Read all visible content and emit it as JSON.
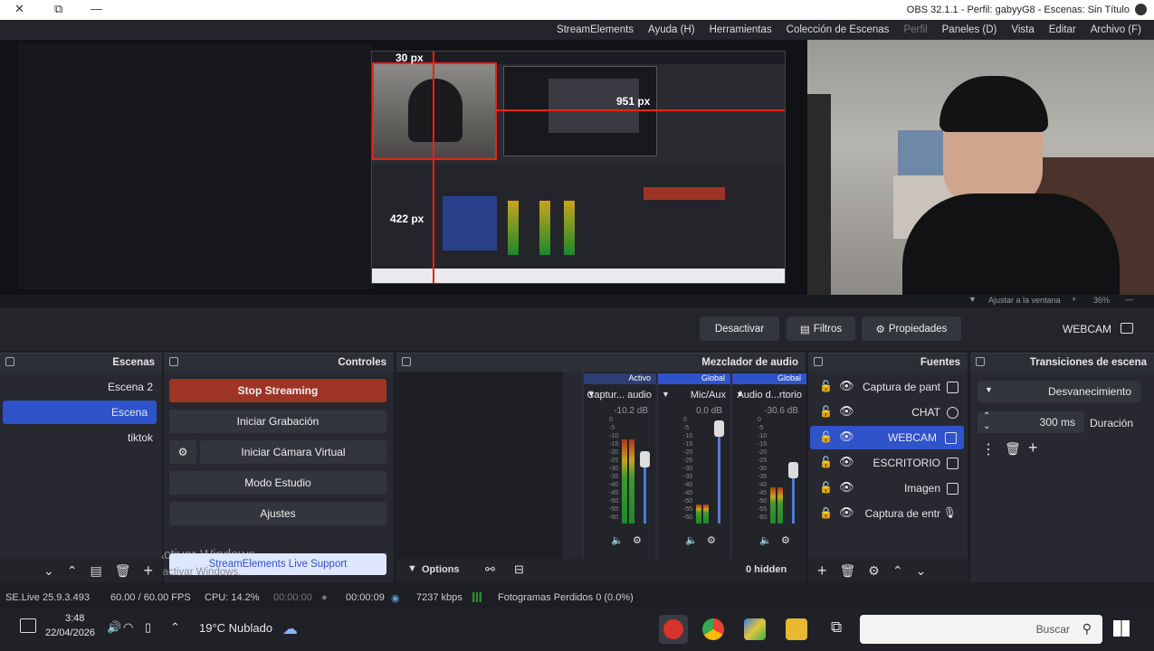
{
  "window": {
    "title": "OBS 32.1.1 - Perfil: gabyyG8 - Escenas: Sin Título",
    "close_glyph": "✕",
    "max_glyph": "⧉",
    "min_glyph": "—"
  },
  "menu": [
    "Archivo (F)",
    "Editar",
    "Vista",
    "Paneles (D)",
    "Perfil",
    "Colección de Escenas",
    "Herramientas",
    "Ayuda (H)",
    "StreamElements"
  ],
  "menu_disabled": [
    "Perfil"
  ],
  "preview": {
    "overlay_top": "30 px",
    "overlay_right": "951 px",
    "overlay_left": "422 px"
  },
  "zoom": {
    "percent": "36%",
    "fit": "Ajustar a la ventana"
  },
  "source_toolbar": {
    "current": "WEBCAM",
    "properties": "Propiedades",
    "filters": "Filtros",
    "deactivate": "Desactivar"
  },
  "transitions": {
    "title": "Transiciones de escena",
    "selected": "Desvanecimiento",
    "duration_label": "Duración",
    "duration_value": "300 ms"
  },
  "sources": {
    "title": "Fuentes",
    "items": [
      {
        "label": "Captura de pant",
        "icon": "monitor-icon"
      },
      {
        "label": "CHAT",
        "icon": "globe-icon"
      },
      {
        "label": "WEBCAM",
        "icon": "camera-icon",
        "selected": true
      },
      {
        "label": "ESCRITORIO",
        "icon": "monitor-icon"
      },
      {
        "label": "Imagen",
        "icon": "image-icon"
      },
      {
        "label": "Captura de entr",
        "icon": "mic-icon"
      }
    ]
  },
  "mixer": {
    "title": "Mezclador de audio",
    "channels": [
      {
        "badge": "Global",
        "name": "Audio d...rtorio",
        "db": "-30.6 dB",
        "level": 0.35,
        "fader": 0.52,
        "active": false
      },
      {
        "badge": "Global",
        "name": "Mic/Aux",
        "db": "0.0 dB",
        "level": 0.18,
        "fader": 0.92,
        "active": false
      },
      {
        "badge": "Activo",
        "name": "Captur... audio",
        "db": "-10.2 dB",
        "level": 0.82,
        "fader": 0.62,
        "active": true
      }
    ],
    "scale": [
      "0",
      "-5",
      "-10",
      "-15",
      "-20",
      "-25",
      "-30",
      "-35",
      "-40",
      "-45",
      "-50",
      "-55",
      "-60"
    ],
    "hidden": "0 hidden",
    "options": "Options"
  },
  "controls": {
    "title": "Controles",
    "stop_streaming": "Stop Streaming",
    "start_recording": "Iniciar Grabación",
    "virtual_camera": "Iniciar Cámara Virtual",
    "studio_mode": "Modo Estudio",
    "settings": "Ajustes",
    "se_support": "StreamElements Live Support",
    "watermark1": "Activar Windows",
    "watermark2": "Ve a Configuración para activar Windows."
  },
  "scenes": {
    "title": "Escenas",
    "items": [
      {
        "label": "Escena 2",
        "selected": false
      },
      {
        "label": "Escena",
        "selected": true
      },
      {
        "label": "tiktok",
        "selected": false
      }
    ]
  },
  "status": {
    "dropped": "Fotogramas Perdidos 0 (0.0%)",
    "bitrate": "7237 kbps",
    "stream_time": "00:00:09",
    "rec_time": "00:00:00",
    "cpu": "CPU: 14.2%",
    "fps": "60.00 / 60.00 FPS",
    "version": "SE.Live 25.9.3.493"
  },
  "taskbar": {
    "search_placeholder": "Buscar",
    "weather": "19°C  Nublado",
    "time": "3:48",
    "date": "22/04/2026"
  },
  "colors": {
    "accent": "#2f53c9",
    "stop_red": "#9e3426"
  }
}
